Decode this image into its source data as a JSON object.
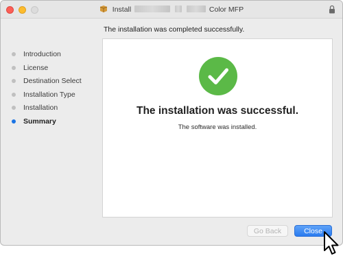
{
  "window": {
    "title_prefix": "Install",
    "title_suffix": "Color MFP",
    "icons": {
      "package": "package-icon",
      "lock": "lock-icon"
    }
  },
  "header": {
    "message": "The installation was completed successfully."
  },
  "sidebar": {
    "steps": [
      {
        "label": "Introduction",
        "active": false
      },
      {
        "label": "License",
        "active": false
      },
      {
        "label": "Destination Select",
        "active": false
      },
      {
        "label": "Installation Type",
        "active": false
      },
      {
        "label": "Installation",
        "active": false
      },
      {
        "label": "Summary",
        "active": true
      }
    ]
  },
  "main": {
    "title": "The installation was successful.",
    "subtitle": "The software was installed.",
    "icon": "checkmark-circle-icon",
    "icon_color": "#5bb947"
  },
  "buttons": {
    "go_back": "Go Back",
    "close": "Close"
  },
  "colors": {
    "accent": "#2a7bef",
    "active_step_dot": "#1b74e4"
  }
}
